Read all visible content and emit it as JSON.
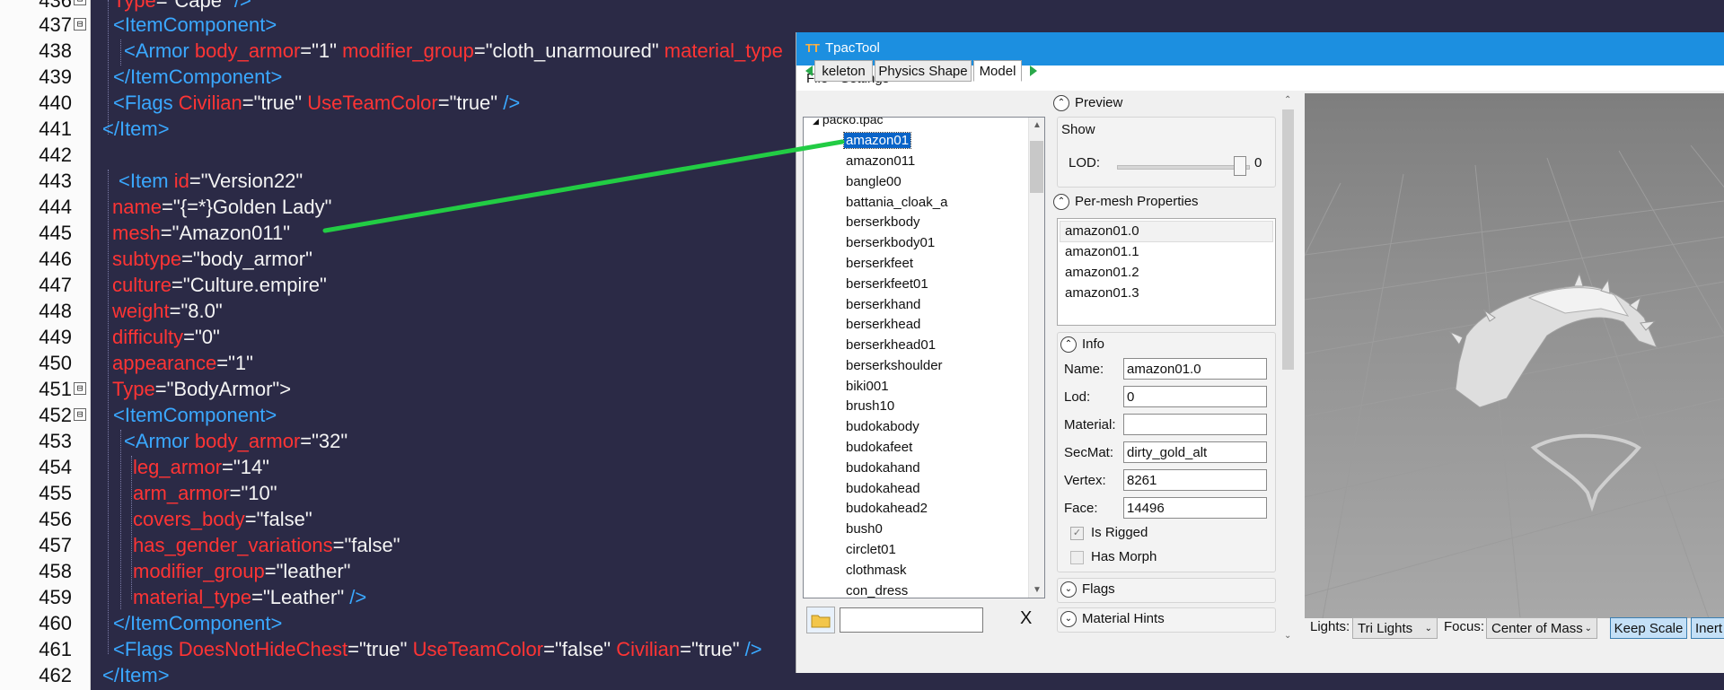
{
  "editor": {
    "line_numbers": [
      "436",
      "437",
      "438",
      "439",
      "440",
      "441",
      "442",
      "443",
      "444",
      "445",
      "446",
      "447",
      "448",
      "449",
      "450",
      "451",
      "452",
      "453",
      "454",
      "455",
      "456",
      "457",
      "458",
      "459",
      "460",
      "461",
      "462"
    ],
    "line_text": {
      "l436_type_attr": "Type",
      "l436_type_val": "\"Cape\"",
      "l436_end": " />",
      "l437": "<ItemComponent>",
      "l438_tag": "<Armor",
      "l438_a1": "body_armor",
      "l438_v1": "\"1\"",
      "l438_a2": "modifier_group",
      "l438_v2": "\"cloth_unarmoured\"",
      "l438_a3": "material_type",
      "l439": "</ItemComponent>",
      "l440_tag": "<Flags",
      "l440_a1": "Civilian",
      "l440_v1": "\"true\"",
      "l440_a2": "UseTeamColor",
      "l440_v2": "\"true\"",
      "l440_end": "/>",
      "l441": "</Item>",
      "l443_tag": "<Item",
      "l443_a1": "id",
      "l443_v1": "\"Version22\"",
      "l444_a": "name",
      "l444_v": "\"{=*}Golden Lady\"",
      "l445_a": "mesh",
      "l445_v": "\"Amazon011\"",
      "l446_a": "subtype",
      "l446_v": "\"body_armor\"",
      "l447_a": "culture",
      "l447_v": "\"Culture.empire\"",
      "l448_a": "weight",
      "l448_v": "\"8.0\"",
      "l449_a": "difficulty",
      "l449_v": "\"0\"",
      "l450_a": "appearance",
      "l450_v": "\"1\"",
      "l451_a": "Type",
      "l451_v": "\"BodyArmor\">",
      "l452": "<ItemComponent>",
      "l453_tag": "<Armor",
      "l453_a": "body_armor",
      "l453_v": "\"32\"",
      "l454_a": "leg_armor",
      "l454_v": "\"14\"",
      "l455_a": "arm_armor",
      "l455_v": "\"10\"",
      "l456_a": "covers_body",
      "l456_v": "\"false\"",
      "l457_a": "has_gender_variations",
      "l457_v": "\"false\"",
      "l458_a": "modifier_group",
      "l458_v": "\"leather\"",
      "l459_a": "material_type",
      "l459_v": "\"Leather\"",
      "l459_end": "/>",
      "l460": "</ItemComponent>",
      "l461_tag": "<Flags",
      "l461_a1": "DoesNotHideChest",
      "l461_v1": "\"true\"",
      "l461_a2": "UseTeamColor",
      "l461_v2": "\"false\"",
      "l461_a3": "Civilian",
      "l461_v3": "\"true\"",
      "l461_end": "/>",
      "l462": "</Item>"
    },
    "fold_marks": [
      "⊟",
      "⊟",
      "⊟",
      "⊟"
    ]
  },
  "window": {
    "logo": "TT",
    "title": "TpacTool",
    "menu": {
      "file": "File",
      "settings": "Settings"
    },
    "tabs": {
      "skeleton": "keleton",
      "physics": "Physics Shape",
      "model": "Model"
    },
    "tree_root": "packo.tpac",
    "tree_items": [
      "amazon01",
      "amazon011",
      "bangle00",
      "battania_cloak_a",
      "berserkbody",
      "berserkbody01",
      "berserkfeet",
      "berserkfeet01",
      "berserkhand",
      "berserkhead",
      "berserkhead01",
      "berserkshoulder",
      "biki001",
      "brush10",
      "budokabody",
      "budokafeet",
      "budokahand",
      "budokahead",
      "budokahead2",
      "bush0",
      "circlet01",
      "clothmask",
      "con_dress"
    ],
    "clear_button": "X",
    "preview": {
      "title": "Preview",
      "show": "Show",
      "lod_label": "LOD:",
      "lod_value": "0"
    },
    "per_mesh": {
      "title": "Per-mesh Properties",
      "items": [
        "amazon01.0",
        "amazon01.1",
        "amazon01.2",
        "amazon01.3"
      ]
    },
    "info": {
      "title": "Info",
      "name_label": "Name:",
      "name_value": "amazon01.0",
      "lod_label": "Lod:",
      "lod_value": "0",
      "material_label": "Material:",
      "material_value": "",
      "secmat_label": "SecMat:",
      "secmat_value": "dirty_gold_alt",
      "vertex_label": "Vertex:",
      "vertex_value": "8261",
      "face_label": "Face:",
      "face_value": "14496",
      "is_rigged_label": "Is Rigged",
      "is_rigged": true,
      "has_morph_label": "Has Morph",
      "has_morph": false
    },
    "flags_title": "Flags",
    "material_hints_title": "Material Hints",
    "bottom": {
      "lights_label": "Lights:",
      "lights_value": "Tri Lights",
      "focus_label": "Focus:",
      "focus_value": "Center of Mass",
      "keep_scale": "Keep Scale",
      "inertia": "Inert"
    }
  },
  "colors": {
    "editor_bg": "#2b2a46",
    "tag": "#3aa8ff",
    "attr": "#ff3434",
    "value": "#f4f4f4",
    "titlebar": "#1c8fe0",
    "arrow": "#22cc44"
  }
}
